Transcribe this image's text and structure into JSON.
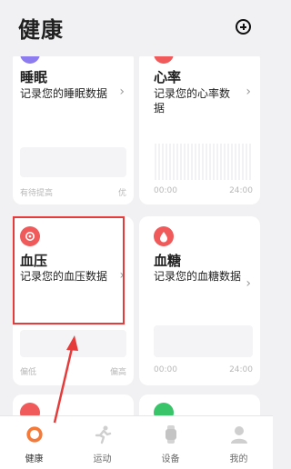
{
  "header": {
    "title": "健康"
  },
  "cards": {
    "sleep": {
      "name": "睡眠",
      "desc": "记录您的睡眠数据",
      "foot_left": "有待提高",
      "foot_right": "优"
    },
    "heart": {
      "name": "心率",
      "desc": "记录您的心率数据",
      "foot_left": "00:00",
      "foot_right": "24:00"
    },
    "bp": {
      "name": "血压",
      "desc": "记录您的血压数据",
      "foot_left": "偏低",
      "foot_right": "偏高"
    },
    "glucose": {
      "name": "血糖",
      "desc": "记录您的血糖数据",
      "foot_left": "00:00",
      "foot_right": "24:00"
    }
  },
  "chevron": "›",
  "tabs": [
    {
      "label": "健康",
      "icon": "health-ring-icon",
      "active": true
    },
    {
      "label": "运动",
      "icon": "running-icon",
      "active": false
    },
    {
      "label": "设备",
      "icon": "watch-icon",
      "active": false
    },
    {
      "label": "我的",
      "icon": "person-icon",
      "active": false
    }
  ],
  "colors": {
    "accent": "#f05a5a",
    "highlight": "#e53b3b",
    "sleep": "#8c7cf0",
    "green": "#3ac46a"
  }
}
